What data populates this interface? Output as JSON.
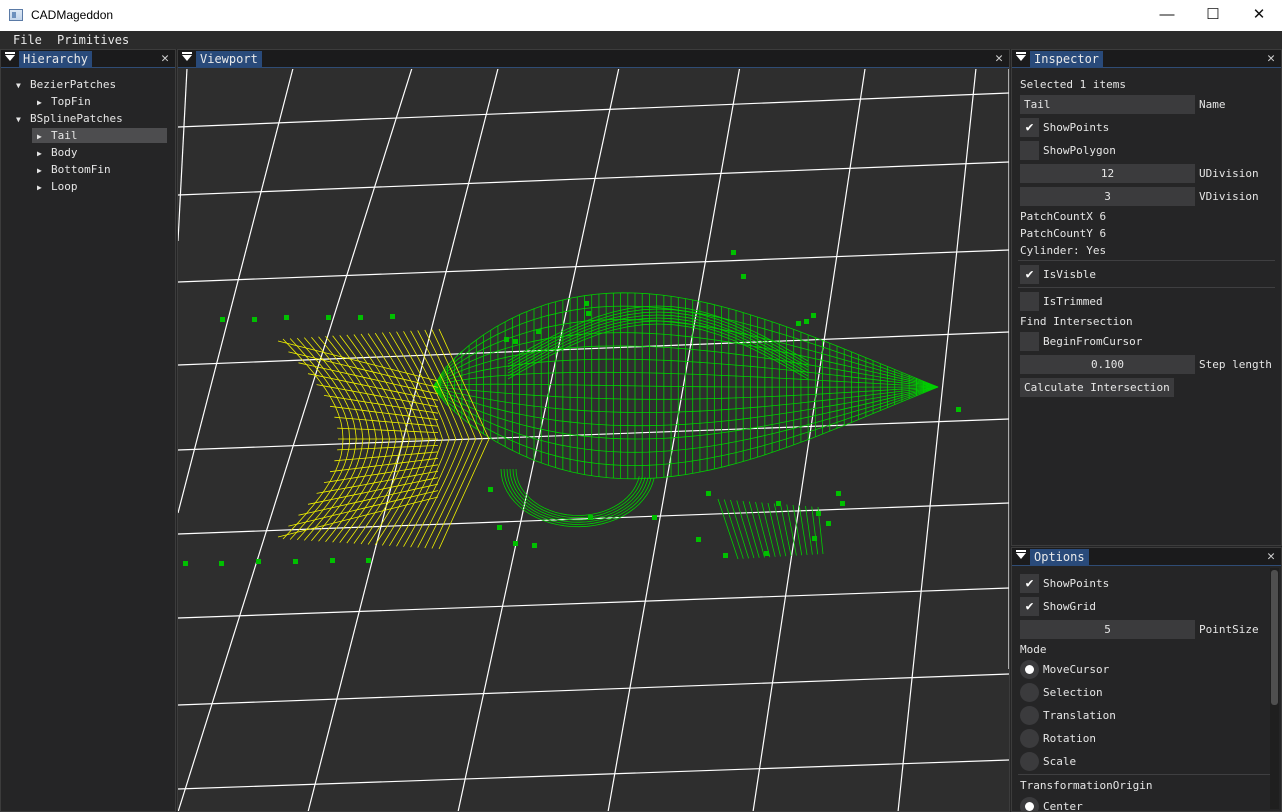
{
  "window": {
    "title": "CADMageddon",
    "minimize_glyph": "—",
    "maximize_glyph": "☐",
    "close_glyph": "✕"
  },
  "menu": {
    "items": [
      "File",
      "Primitives"
    ]
  },
  "hierarchy": {
    "tab": "Hierarchy",
    "close_glyph": "✕",
    "groups": [
      {
        "label": "BezierPatches",
        "children": [
          "TopFin"
        ]
      },
      {
        "label": "BSplinePatches",
        "children": [
          "Tail",
          "Body",
          "BottomFin",
          "Loop"
        ]
      }
    ],
    "selected": "Tail"
  },
  "viewport": {
    "tab": "Viewport",
    "close_glyph": "✕",
    "colors": {
      "background": "#2e2e2e",
      "grid": "#ffffff",
      "tail": "#ffff00",
      "body": "#00cc00",
      "points": "#00c000"
    }
  },
  "inspector": {
    "tab": "Inspector",
    "close_glyph": "✕",
    "selected_text": "Selected 1 items",
    "name_value": "Tail",
    "name_label": "Name",
    "show_points_label": "ShowPoints",
    "show_points_checked": true,
    "show_polygon_label": "ShowPolygon",
    "show_polygon_checked": false,
    "udivision_value": "12",
    "udivision_label": "UDivision",
    "vdivision_value": "3",
    "vdivision_label": "VDivision",
    "patch_count_x": "PatchCountX 6",
    "patch_count_y": "PatchCountY 6",
    "cylinder": "Cylinder: Yes",
    "is_visible_label": "IsVisble",
    "is_visible_checked": true,
    "is_trimmed_label": "IsTrimmed",
    "is_trimmed_checked": false,
    "find_intersection": "Find Intersection",
    "begin_from_cursor_label": "BeginFromCursor",
    "begin_from_cursor_checked": false,
    "step_length_value": "0.100",
    "step_length_label": "Step length",
    "calculate_button": "Calculate Intersection",
    "check_glyph": "✔"
  },
  "options": {
    "tab": "Options",
    "close_glyph": "✕",
    "show_points_label": "ShowPoints",
    "show_points_checked": true,
    "show_grid_label": "ShowGrid",
    "show_grid_checked": true,
    "point_size_value": "5",
    "point_size_label": "PointSize",
    "mode_label": "Mode",
    "modes": [
      "MoveCursor",
      "Selection",
      "Translation",
      "Rotation",
      "Scale"
    ],
    "mode_selected": "MoveCursor",
    "transformation_origin_label": "TransformationOrigin",
    "origin_options": [
      "Center"
    ],
    "origin_selected": "Center",
    "check_glyph": "✔"
  }
}
